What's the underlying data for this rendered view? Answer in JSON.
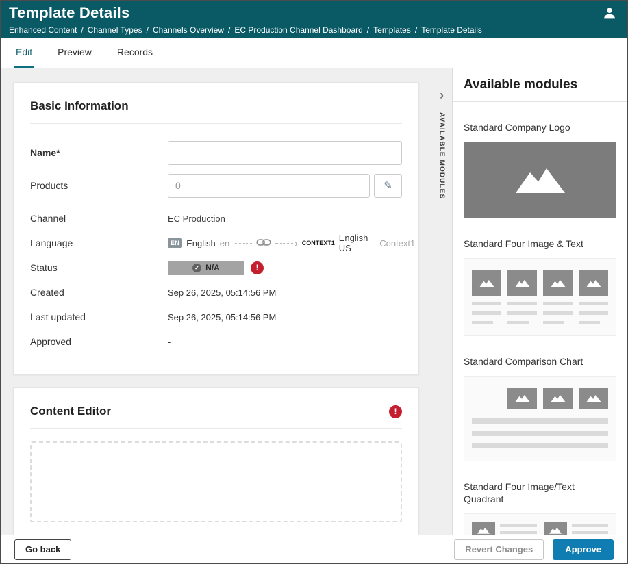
{
  "header": {
    "title": "Template Details",
    "separator": "/",
    "breadcrumbs": [
      {
        "label": "Enhanced Content"
      },
      {
        "label": "Channel Types"
      },
      {
        "label": "Channels Overview"
      },
      {
        "label": "EC Production Channel Dashboard"
      },
      {
        "label": "Templates"
      },
      {
        "label": "Template Details"
      }
    ]
  },
  "tabs": [
    {
      "label": "Edit",
      "active": true
    },
    {
      "label": "Preview",
      "active": false
    },
    {
      "label": "Records",
      "active": false
    }
  ],
  "basic_info": {
    "title": "Basic Information",
    "name_label": "Name*",
    "name_value": "",
    "products_label": "Products",
    "products_value": "0",
    "channel_label": "Channel",
    "channel_value": "EC Production",
    "language_label": "Language",
    "language": {
      "source_badge": "EN",
      "source_name": "English",
      "source_code": "en",
      "target_badge": "CONTEXT1",
      "target_name": "English US",
      "target_context": "Context1"
    },
    "status_label": "Status",
    "status_value": "N/A",
    "created_label": "Created",
    "created_value": "Sep 26, 2025, 05:14:56 PM",
    "last_updated_label": "Last updated",
    "last_updated_value": "Sep 26, 2025, 05:14:56 PM",
    "approved_label": "Approved",
    "approved_value": "-"
  },
  "content_editor": {
    "title": "Content Editor"
  },
  "modules_panel": {
    "title": "Available modules",
    "collapsed_label": "AVAILABLE MODULES",
    "modules": [
      {
        "name": "Standard Company Logo"
      },
      {
        "name": "Standard Four Image & Text"
      },
      {
        "name": "Standard Comparison Chart"
      },
      {
        "name": "Standard Four Image/Text Quadrant"
      }
    ]
  },
  "footer": {
    "go_back_label": "Go back",
    "revert_label": "Revert Changes",
    "approve_label": "Approve"
  },
  "icons": {
    "user": "person-silhouette",
    "link": "chain-link",
    "mountain": "image-placeholder",
    "chevron_right": "›",
    "exclamation": "!",
    "check": "✓",
    "pencil": "✎",
    "link_arrow": "›"
  },
  "colors": {
    "header_teal": "#0a5a66",
    "tab_active_teal": "#0d7280",
    "approve_blue": "#0f7cb2",
    "error_red": "#c41e2f",
    "status_badge_gray": "#a3a3a3",
    "module_placeholder_gray": "#7c7c7c"
  }
}
